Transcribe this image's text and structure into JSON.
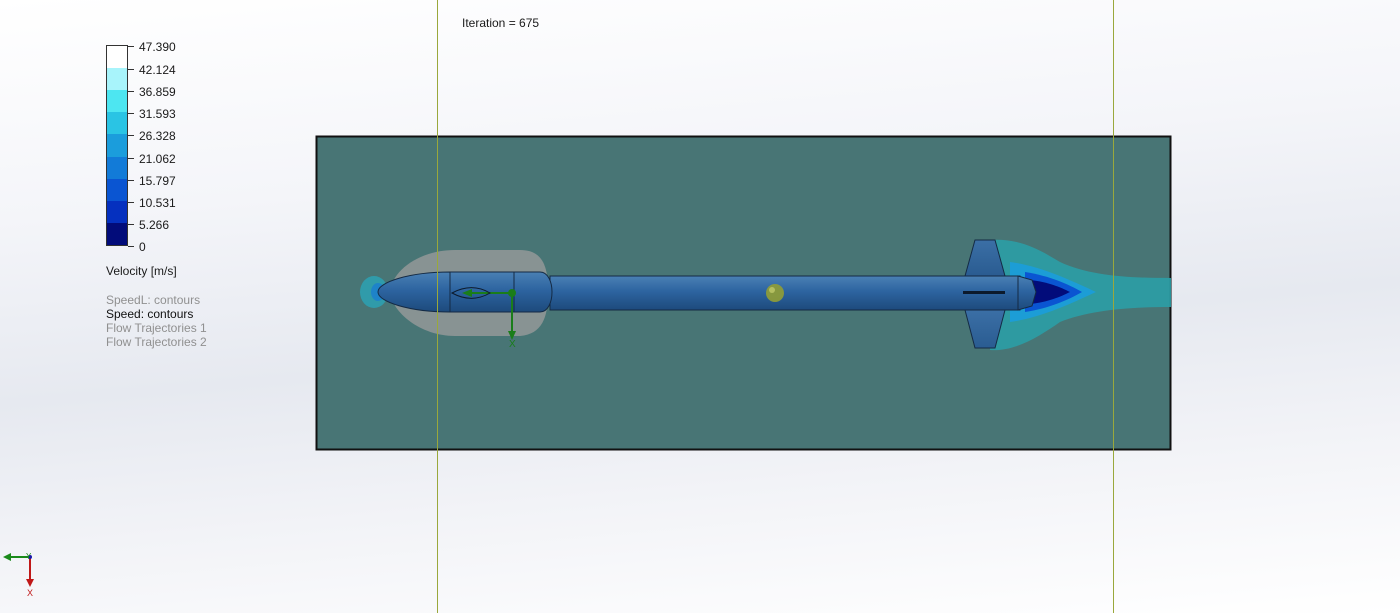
{
  "iteration_text": "Iteration = 675",
  "legend": {
    "title": "Velocity [m/s]",
    "ticks": [
      "47.390",
      "42.124",
      "36.859",
      "31.593",
      "26.328",
      "21.062",
      "15.797",
      "10.531",
      "5.266",
      "0"
    ],
    "colors": [
      "#ffffff",
      "#a8f4fb",
      "#4de6f1",
      "#2ac4e4",
      "#1b9ddc",
      "#127bd8",
      "#0a55d2",
      "#0530bf",
      "#031aa3",
      "#020c7a"
    ]
  },
  "plots": [
    {
      "label": "SpeedL: contours",
      "active": false
    },
    {
      "label": "Speed: contours",
      "active": true
    },
    {
      "label": "Flow Trajectories 1",
      "active": false
    },
    {
      "label": "Flow Trajectories 2",
      "active": false
    }
  ],
  "triad": {
    "x_label": "X",
    "y_label": "Y"
  },
  "model_triad": {
    "x_label": "X"
  },
  "colors": {
    "domain_fill": "#487575",
    "body_fill": "#2a5d93",
    "guide_line": "#9aa83c"
  }
}
